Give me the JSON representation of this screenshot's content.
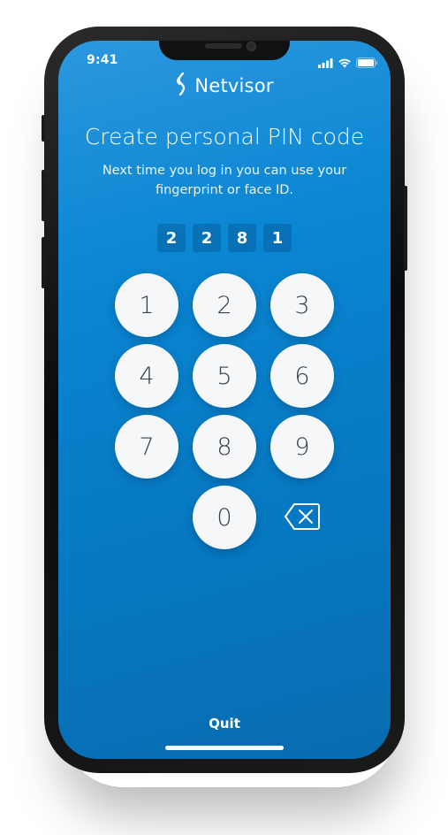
{
  "status_bar": {
    "time": "9:41",
    "icons": [
      "cellular-signal-icon",
      "wifi-icon",
      "battery-icon"
    ]
  },
  "brand": {
    "logo_icon": "netvisor-logo-icon",
    "name": "Netvisor"
  },
  "header": {
    "title": "Create personal PIN code",
    "subtitle": "Next time you log in you can use your fingerprint or face ID."
  },
  "pin": {
    "digits": [
      "2",
      "2",
      "8",
      "1"
    ]
  },
  "keypad": {
    "k1": "1",
    "k2": "2",
    "k3": "3",
    "k4": "4",
    "k5": "5",
    "k6": "6",
    "k7": "7",
    "k8": "8",
    "k9": "9",
    "k0": "0",
    "backspace_icon": "backspace-icon"
  },
  "footer": {
    "quit_label": "Quit"
  },
  "colors": {
    "background_top": "#2c97de",
    "background_bottom": "#086bb0",
    "key_background": "#f5f7f9",
    "key_text": "#3a3f45"
  }
}
